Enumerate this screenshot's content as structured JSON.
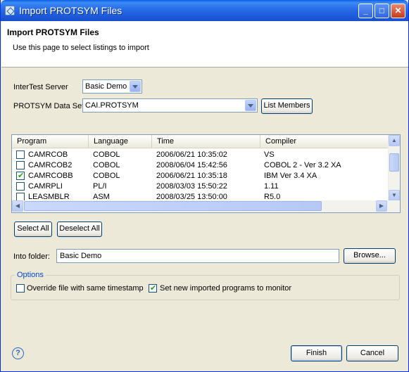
{
  "window": {
    "title": "Import PROTSYM Files"
  },
  "banner": {
    "title": "Import PROTSYM Files",
    "description": "Use this page to select listings to import"
  },
  "server": {
    "label": "InterTest Server",
    "value": "Basic Demo"
  },
  "dataset": {
    "label": "PROTSYM Data Set",
    "value": "CAI.PROTSYM",
    "list_button": "List Members"
  },
  "table": {
    "columns": [
      "Program",
      "Language",
      "Time",
      "Compiler"
    ],
    "rows": [
      {
        "checked": false,
        "program": "CAMRCOB",
        "language": "COBOL",
        "time": "2006/06/21 10:35:02",
        "compiler": "VS"
      },
      {
        "checked": false,
        "program": "CAMRCOB2",
        "language": "COBOL",
        "time": "2008/06/04 15:42:56",
        "compiler": "COBOL 2 - Ver 3.2 XA"
      },
      {
        "checked": true,
        "program": "CAMRCOBB",
        "language": "COBOL",
        "time": "2006/06/21 10:35:18",
        "compiler": "IBM Ver 3.4 XA"
      },
      {
        "checked": false,
        "program": "CAMRPLI",
        "language": "PL/I",
        "time": "2008/03/03 15:50:22",
        "compiler": "1.11"
      },
      {
        "checked": false,
        "program": "LEASMBLR",
        "language": "ASM",
        "time": "2008/03/25 13:50:00",
        "compiler": "R5.0"
      }
    ]
  },
  "selection": {
    "select_all": "Select All",
    "deselect_all": "Deselect All"
  },
  "folder": {
    "label": "Into folder:",
    "value": "Basic Demo",
    "browse": "Browse..."
  },
  "options": {
    "title": "Options",
    "override_label": "Override file with same timestamp",
    "override_checked": false,
    "monitor_label": "Set new imported programs to monitor",
    "monitor_checked": true
  },
  "footer": {
    "finish": "Finish",
    "cancel": "Cancel"
  },
  "colors": {
    "title_bar": "#2a6fe9",
    "group_title": "#0046d5"
  }
}
